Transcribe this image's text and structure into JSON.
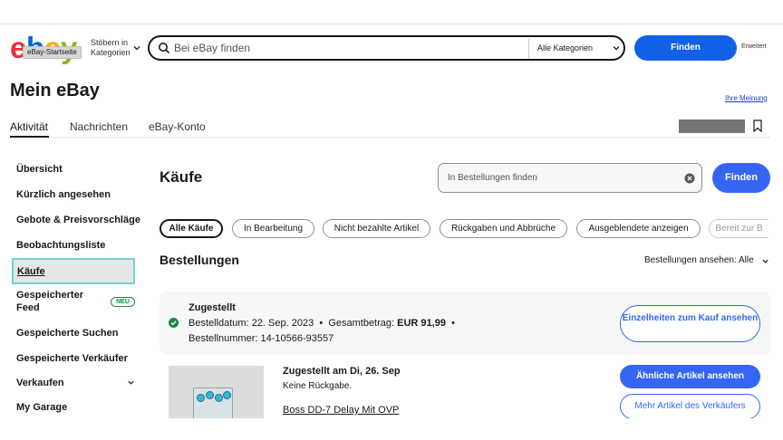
{
  "header": {
    "logo_text": "ebay",
    "logo_tooltip": "eBay-Startseite",
    "browse_label": "Stöbern in Kategorien",
    "search_placeholder": "Bei eBay finden",
    "category_select": "Alle Kategorien",
    "search_button": "Finden",
    "advanced_link": "Erweitert"
  },
  "page": {
    "title": "Mein eBay",
    "feedback_link": "Ihre Meinung"
  },
  "tabs": [
    {
      "label": "Aktivität",
      "active": true
    },
    {
      "label": "Nachrichten",
      "active": false
    },
    {
      "label": "eBay-Konto",
      "active": false
    }
  ],
  "sidebar": {
    "items": [
      {
        "label": "Übersicht"
      },
      {
        "label": "Kürzlich angesehen"
      },
      {
        "label": "Gebote & Preisvorschläge"
      },
      {
        "label": "Beobachtungsliste"
      },
      {
        "label": "Käufe",
        "active": true
      },
      {
        "label": "Gespeicherter Feed",
        "badge": "NEU"
      },
      {
        "label": "Gespeicherte Suchen"
      },
      {
        "label": "Gespeicherte Verkäufer"
      },
      {
        "label": "Verkaufen"
      },
      {
        "label": "My Garage"
      }
    ]
  },
  "main": {
    "title": "Käufe",
    "order_search_placeholder": "In Bestellungen finden",
    "search_button": "Finden",
    "filters": [
      {
        "label": "Alle Käufe",
        "active": true
      },
      {
        "label": "In Bearbeitung"
      },
      {
        "label": "Nicht bezahlte Artikel"
      },
      {
        "label": "Rückgaben und Abbrüche"
      },
      {
        "label": "Ausgeblendete anzeigen"
      },
      {
        "label": "Bereit zur B"
      }
    ],
    "orders_heading": "Bestellungen",
    "view_label": "Bestellungen ansehen:",
    "view_value": "Alle",
    "order": {
      "status": "Zugestellt",
      "date_label": "Bestelldatum: 22. Sep. 2023",
      "total_label": "Gesamtbetrag:",
      "total_value": "EUR 91,99",
      "order_number": "Bestellnummer: 14-10566-93557",
      "details_button": "Einzelheiten zum Kauf ansehen"
    },
    "item": {
      "status": "Zugestellt am Di, 26. Sep",
      "return_policy": "Keine Rückgabe.",
      "title": "Boss DD-7 Delay Mit OVP",
      "similar_button": "Ähnliche Artikel ansehen",
      "seller_button": "Mehr Artikel des Verkäufers"
    }
  },
  "colors": {
    "primary": "#3665f3",
    "active_outline": "#70d1d9",
    "success": "#1a8a3a"
  }
}
